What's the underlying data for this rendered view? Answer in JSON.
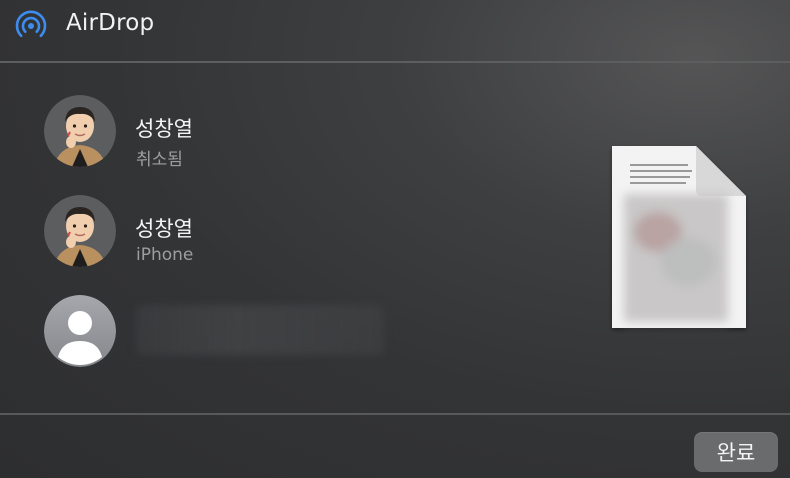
{
  "header": {
    "title": "AirDrop",
    "icon": "airdrop-icon"
  },
  "recipients": [
    {
      "name": "성창열",
      "status": "취소됨",
      "avatar": "memoji-avatar"
    },
    {
      "name": "성창열",
      "status": "iPhone",
      "avatar": "memoji-avatar"
    },
    {
      "name": "",
      "status": "",
      "avatar": "default-person-avatar"
    }
  ],
  "document": {
    "icon": "document-preview-icon"
  },
  "footer": {
    "done_label": "완료"
  },
  "colors": {
    "accent": "#3d8cf0",
    "background": "#333436",
    "button": "#6a6b6d"
  }
}
